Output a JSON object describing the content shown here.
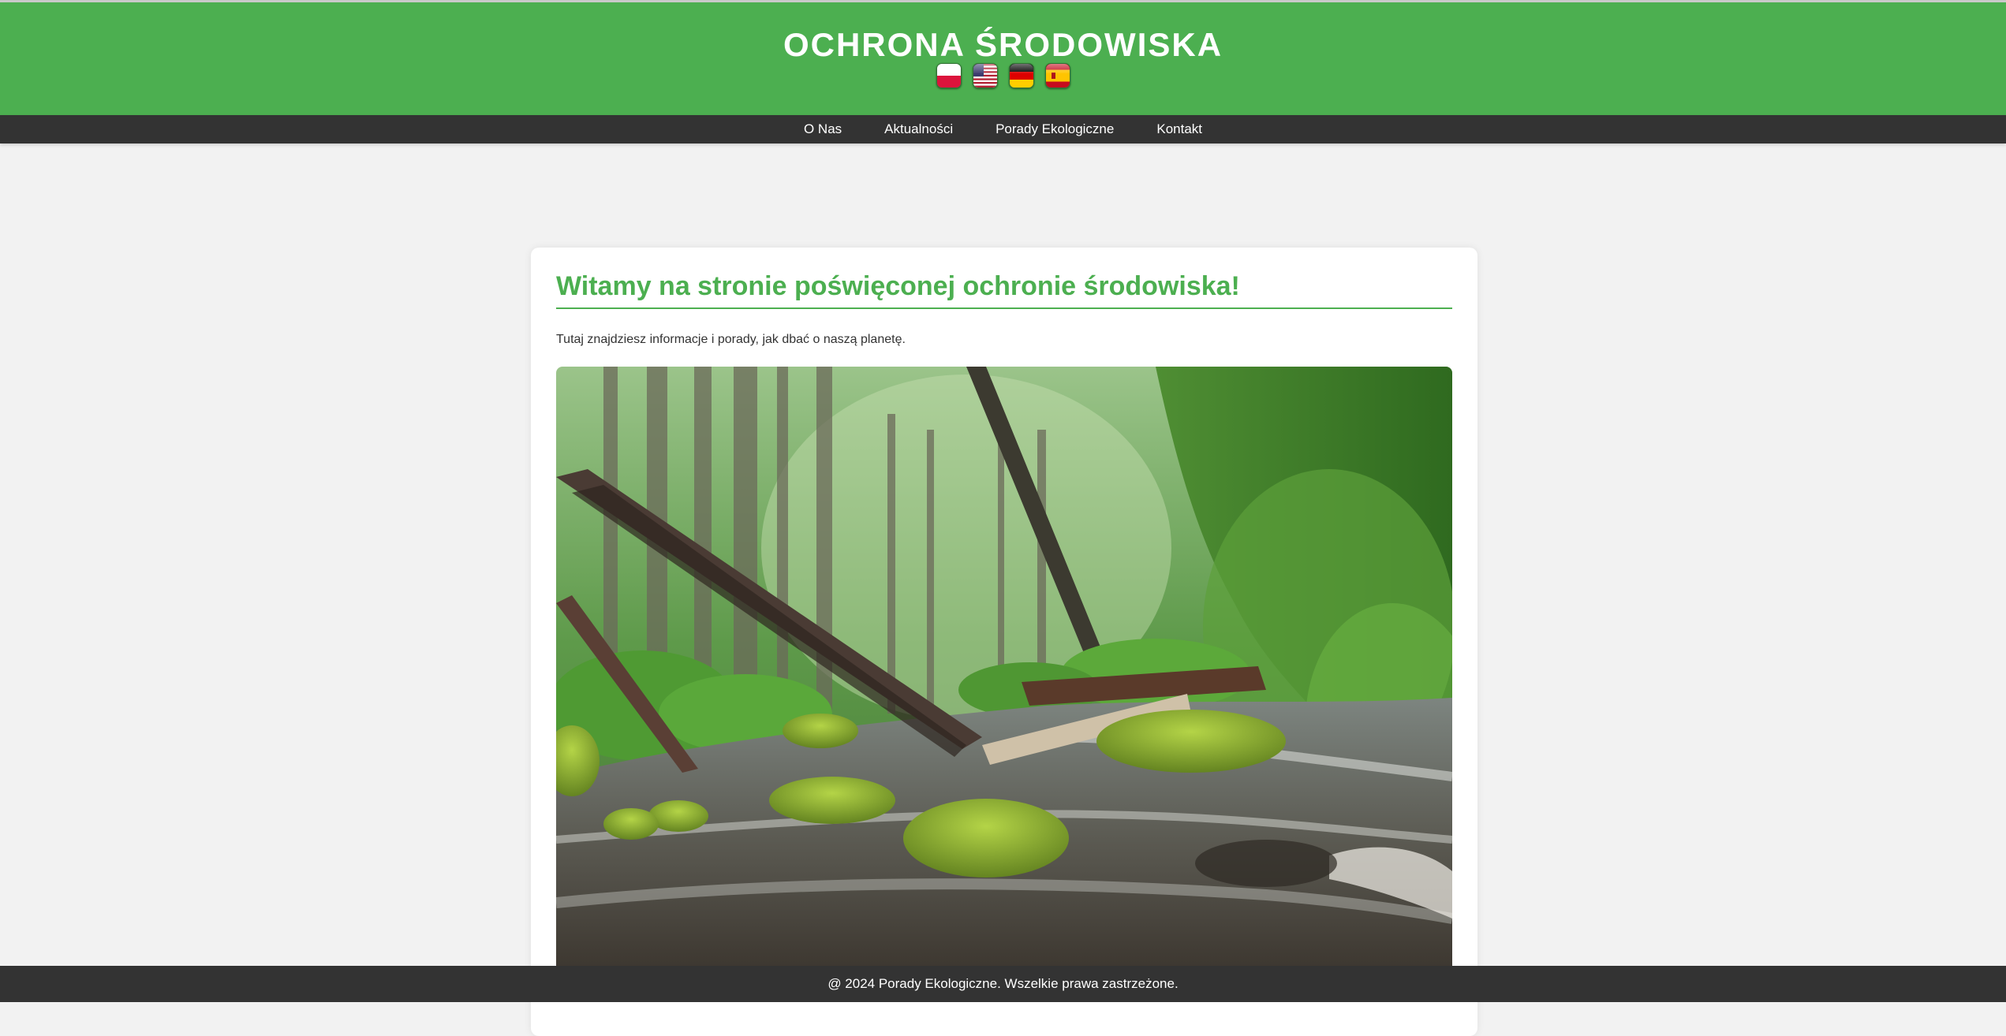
{
  "header": {
    "title": "OCHRONA ŚRODOWISKA",
    "languages": [
      {
        "icon": "poland-flag-icon"
      },
      {
        "icon": "usa-flag-icon"
      },
      {
        "icon": "germany-flag-icon"
      },
      {
        "icon": "spain-flag-icon"
      }
    ],
    "background_color": "#4caf50"
  },
  "nav": {
    "items": [
      {
        "label": "O Nas"
      },
      {
        "label": "Aktualności"
      },
      {
        "label": "Porady Ekologiczne"
      },
      {
        "label": "Kontakt"
      }
    ],
    "background_color": "#333333"
  },
  "main": {
    "heading": "Witamy na stronie poświęconej ochronie środowiska!",
    "intro": "Tutaj znajdziesz informacje i porady, jak dbać o naszą planetę.",
    "image": {
      "icon": "forest-river-photo"
    }
  },
  "footer": {
    "text": "@ 2024 Porady Ekologiczne. Wszelkie prawa zastrzeżone."
  }
}
